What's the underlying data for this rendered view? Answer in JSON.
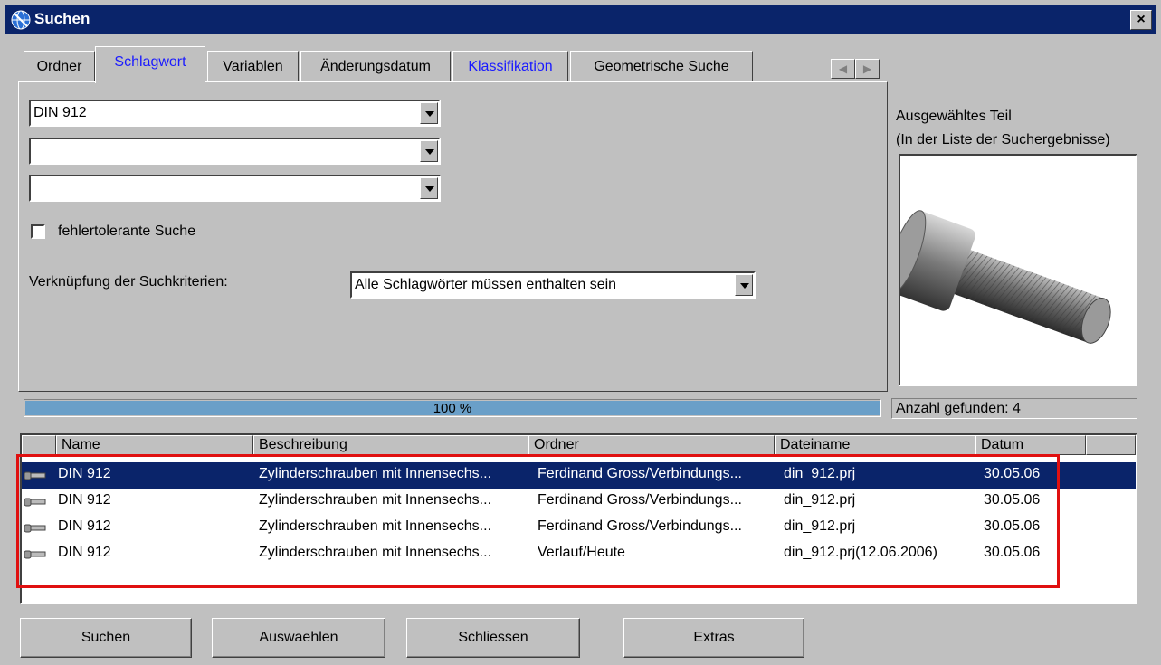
{
  "window": {
    "title": "Suchen",
    "close_label": "×"
  },
  "tabs": [
    {
      "label": "Ordner"
    },
    {
      "label": "Schlagwort"
    },
    {
      "label": "Variablen"
    },
    {
      "label": "Änderungsdatum"
    },
    {
      "label": "Klassifikation"
    },
    {
      "label": "Geometrische Suche"
    }
  ],
  "tab_scroll": {
    "left": "◀",
    "right": "▶"
  },
  "search": {
    "keyword1": "DIN 912",
    "keyword2": "",
    "keyword3": "",
    "fuzzy_label": "fehlertolerante Suche",
    "fuzzy_checked": false,
    "link_label": "Verknüpfung der Suchkriterien:",
    "link_value": "Alle Schlagwörter müssen enthalten sein"
  },
  "preview": {
    "label_line1": "Ausgewähltes Teil",
    "label_line2": "(In der Liste der Suchergebnisse)"
  },
  "progress": {
    "text": "100 %",
    "fraction": 1.0
  },
  "count": "Anzahl gefunden: 4",
  "results": {
    "columns": [
      "Name",
      "Beschreibung",
      "Ordner",
      "Dateiname",
      "Datum"
    ],
    "rows": [
      {
        "name": "DIN 912",
        "desc": "Zylinderschrauben mit Innensechs...",
        "folder": "Ferdinand Gross/Verbindungs...",
        "file": "din_912.prj",
        "date": "30.05.06"
      },
      {
        "name": "DIN 912",
        "desc": "Zylinderschrauben mit Innensechs...",
        "folder": "Ferdinand Gross/Verbindungs...",
        "file": "din_912.prj",
        "date": "30.05.06"
      },
      {
        "name": "DIN 912",
        "desc": "Zylinderschrauben mit Innensechs...",
        "folder": "Ferdinand Gross/Verbindungs...",
        "file": "din_912.prj",
        "date": "30.05.06"
      },
      {
        "name": "DIN 912",
        "desc": "Zylinderschrauben mit Innensechs...",
        "folder": "Verlauf/Heute",
        "file": "din_912.prj(12.06.2006)",
        "date": "30.05.06"
      }
    ]
  },
  "buttons": {
    "search": "Suchen",
    "select": "Auswaehlen",
    "close": "Schliessen",
    "extras": "Extras"
  },
  "colors": {
    "titlebar": "#0a246a",
    "selection": "#0a246a",
    "progress": "#6a9fc8",
    "highlight_box": "#e01010",
    "tab_active": "#1a1aff"
  }
}
